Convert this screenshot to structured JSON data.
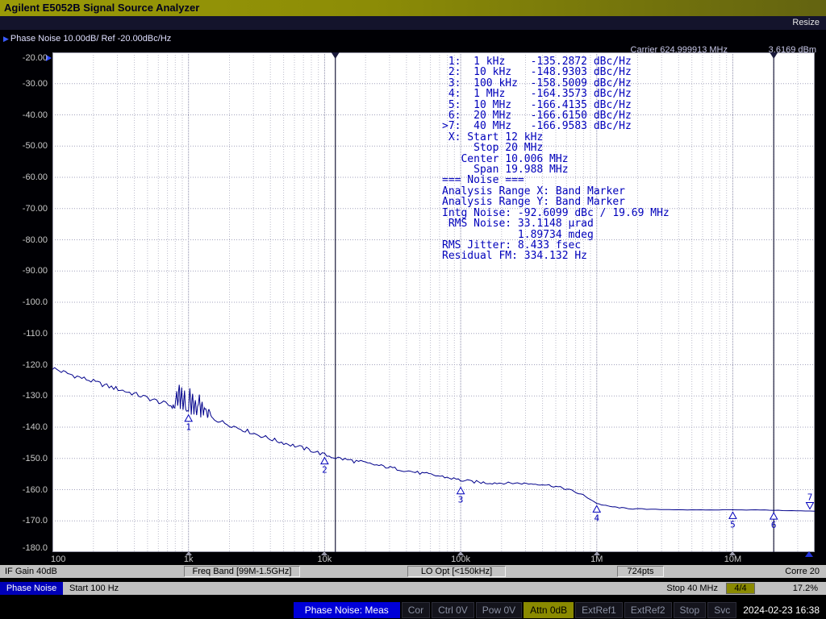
{
  "window": {
    "title": "Agilent E5052B Signal Source Analyzer",
    "resize_label": "Resize"
  },
  "header": {
    "scale_label": "Phase Noise 10.00dB/ Ref -20.00dBc/Hz",
    "carrier_label": "Carrier 624.999913 MHz",
    "carrier_power": "3.6169 dBm"
  },
  "marker_panel": {
    "lines": [
      " 1:  1 kHz    -135.2872 dBc/Hz",
      " 2:  10 kHz   -148.9303 dBc/Hz",
      " 3:  100 kHz  -158.5009 dBc/Hz",
      " 4:  1 MHz    -164.3573 dBc/Hz",
      " 5:  10 MHz   -166.4135 dBc/Hz",
      " 6:  20 MHz   -166.6150 dBc/Hz",
      ">7:  40 MHz   -166.9583 dBc/Hz",
      " X: Start 12 kHz",
      "     Stop 20 MHz",
      "   Center 10.006 MHz",
      "     Span 19.988 MHz",
      "=== Noise ===",
      "Analysis Range X: Band Marker",
      "Analysis Range Y: Band Marker",
      "Intg Noise: -92.6099 dBc / 19.69 MHz",
      " RMS Noise: 33.1148 µrad",
      "            1.89734 mdeg",
      "RMS Jitter: 8.433 fsec",
      "Residual FM: 334.132 Hz"
    ]
  },
  "status_bar1": {
    "if_gain": "IF Gain 40dB",
    "freq_band": "Freq Band [99M-1.5GHz]",
    "lo_opt": "LO Opt [<150kHz]",
    "points": "724pts",
    "corre": "Corre 20"
  },
  "status_bar2": {
    "mode": "Phase Noise",
    "start": "Start 100 Hz",
    "stop": "Stop 40 MHz",
    "avg": "4/4",
    "percent": "17.2%"
  },
  "taskbar": {
    "meas": "Phase Noise: Meas",
    "items": [
      {
        "label": "Cor",
        "state": "dim"
      },
      {
        "label": "Ctrl 0V",
        "state": "dim"
      },
      {
        "label": "Pow 0V",
        "state": "dim"
      },
      {
        "label": "Attn 0dB",
        "state": "olive"
      },
      {
        "label": "ExtRef1",
        "state": "dim"
      },
      {
        "label": "ExtRef2",
        "state": "dim"
      },
      {
        "label": "Stop",
        "state": "dim"
      },
      {
        "label": "Svc",
        "state": "dim"
      }
    ],
    "datetime": "2024-02-23 16:38"
  },
  "chart_data": {
    "type": "line",
    "title": "Phase Noise 10.00dB/ Ref -20.00dBc/Hz",
    "x_axis": {
      "scale": "log",
      "unit": "Hz",
      "min": 100,
      "max": 40000000,
      "ticks": [
        {
          "hz": 100,
          "label": "100"
        },
        {
          "hz": 1000,
          "label": "1k"
        },
        {
          "hz": 10000,
          "label": "10k"
        },
        {
          "hz": 100000,
          "label": "100k"
        },
        {
          "hz": 1000000,
          "label": "1M"
        },
        {
          "hz": 10000000,
          "label": "10M"
        }
      ]
    },
    "y_axis": {
      "unit": "dBc/Hz",
      "max": -20,
      "min": -180,
      "step": 10,
      "tick_labels": [
        "-20.00",
        "-30.00",
        "-40.00",
        "-50.00",
        "-60.00",
        "-70.00",
        "-80.00",
        "-90.00",
        "-100.0",
        "-110.0",
        "-120.0",
        "-130.0",
        "-140.0",
        "-150.0",
        "-160.0",
        "-170.0",
        "-180.0"
      ]
    },
    "band_markers_hz": [
      12000,
      20000000
    ],
    "markers": [
      {
        "id": "1",
        "hz": 1000,
        "dbc": -135.2872
      },
      {
        "id": "2",
        "hz": 10000,
        "dbc": -148.9303
      },
      {
        "id": "3",
        "hz": 100000,
        "dbc": -158.5009
      },
      {
        "id": "4",
        "hz": 1000000,
        "dbc": -164.3573
      },
      {
        "id": "5",
        "hz": 10000000,
        "dbc": -166.4135
      },
      {
        "id": "6",
        "hz": 20000000,
        "dbc": -166.615
      },
      {
        "id": "7",
        "hz": 40000000,
        "dbc": -166.9583,
        "active": true
      }
    ],
    "trace": {
      "name": "phase-noise-trace",
      "color": "#00008b",
      "points": [
        [
          100,
          -121
        ],
        [
          112,
          -121.9
        ],
        [
          125,
          -122.6
        ],
        [
          140,
          -123.3
        ],
        [
          158,
          -124
        ],
        [
          178,
          -124.7
        ],
        [
          200,
          -125.4
        ],
        [
          224,
          -126.1
        ],
        [
          251,
          -126.8
        ],
        [
          282,
          -127.4
        ],
        [
          316,
          -128
        ],
        [
          355,
          -128.7
        ],
        [
          398,
          -129.3
        ],
        [
          447,
          -130
        ],
        [
          501,
          -130.7
        ],
        [
          562,
          -131.4
        ],
        [
          631,
          -132.1
        ],
        [
          708,
          -132.8
        ],
        [
          760,
          -133.3
        ],
        [
          794,
          -133.6
        ],
        [
          820,
          -128.5
        ],
        [
          832,
          -133.8
        ],
        [
          855,
          -125.8
        ],
        [
          870,
          -134
        ],
        [
          891,
          -127.2
        ],
        [
          912,
          -134.2
        ],
        [
          935,
          -129
        ],
        [
          955,
          -134.4
        ],
        [
          1000,
          -135.3
        ],
        [
          1023,
          -127
        ],
        [
          1047,
          -135.5
        ],
        [
          1072,
          -129.5
        ],
        [
          1096,
          -135.7
        ],
        [
          1122,
          -131
        ],
        [
          1148,
          -135.9
        ],
        [
          1202,
          -130.2
        ],
        [
          1230,
          -136.2
        ],
        [
          1259,
          -132
        ],
        [
          1288,
          -136.4
        ],
        [
          1318,
          -133.5
        ],
        [
          1380,
          -136.7
        ],
        [
          1413,
          -134.5
        ],
        [
          1479,
          -137.1
        ],
        [
          1585,
          -137.6
        ],
        [
          1778,
          -138.4
        ],
        [
          1995,
          -139.2
        ],
        [
          2239,
          -140
        ],
        [
          2512,
          -140.8
        ],
        [
          2818,
          -141.5
        ],
        [
          3162,
          -142.3
        ],
        [
          3548,
          -143
        ],
        [
          3981,
          -143.7
        ],
        [
          4467,
          -144.4
        ],
        [
          5012,
          -145
        ],
        [
          5623,
          -145.6
        ],
        [
          6310,
          -146.2
        ],
        [
          7079,
          -146.8
        ],
        [
          7943,
          -147.4
        ],
        [
          8913,
          -148.1
        ],
        [
          10000,
          -148.9
        ],
        [
          11220,
          -149.4
        ],
        [
          12589,
          -149.9
        ],
        [
          14125,
          -150.3
        ],
        [
          15849,
          -150.7
        ],
        [
          17783,
          -151.1
        ],
        [
          19953,
          -151.5
        ],
        [
          22387,
          -151.9
        ],
        [
          25119,
          -152.3
        ],
        [
          28184,
          -152.7
        ],
        [
          31623,
          -153.1
        ],
        [
          35481,
          -153.5
        ],
        [
          39811,
          -153.9
        ],
        [
          44668,
          -154.3
        ],
        [
          50119,
          -154.7
        ],
        [
          56234,
          -155
        ],
        [
          63096,
          -155.4
        ],
        [
          70795,
          -155.7
        ],
        [
          79433,
          -156.1
        ],
        [
          89125,
          -156.5
        ],
        [
          100000,
          -157
        ],
        [
          112202,
          -157.3
        ],
        [
          125893,
          -157.5
        ],
        [
          141254,
          -157.7
        ],
        [
          158489,
          -157.8
        ],
        [
          177828,
          -157.8
        ],
        [
          199526,
          -157.9
        ],
        [
          223872,
          -157.9
        ],
        [
          251189,
          -157.9
        ],
        [
          281838,
          -158
        ],
        [
          316228,
          -158.1
        ],
        [
          354813,
          -158.2
        ],
        [
          398107,
          -158.3
        ],
        [
          446684,
          -158.6
        ],
        [
          501187,
          -159
        ],
        [
          562341,
          -159.5
        ],
        [
          630957,
          -160.1
        ],
        [
          707946,
          -160.9
        ],
        [
          794328,
          -161.8
        ],
        [
          891251,
          -163
        ],
        [
          1000000,
          -164.4
        ],
        [
          1122018,
          -165
        ],
        [
          1258925,
          -165.4
        ],
        [
          1412538,
          -165.7
        ],
        [
          1584893,
          -165.9
        ],
        [
          1778279,
          -166.1
        ],
        [
          1995262,
          -166.2
        ],
        [
          2511886,
          -166.3
        ],
        [
          3162278,
          -166.4
        ],
        [
          3981072,
          -166.4
        ],
        [
          5011872,
          -166.5
        ],
        [
          6309573,
          -166.5
        ],
        [
          7943282,
          -166.5
        ],
        [
          10000000,
          -166.4
        ],
        [
          12589254,
          -166.5
        ],
        [
          15848932,
          -166.5
        ],
        [
          19952623,
          -166.6
        ],
        [
          25118864,
          -166.7
        ],
        [
          31622777,
          -166.8
        ],
        [
          40000000,
          -166.9
        ]
      ]
    }
  }
}
